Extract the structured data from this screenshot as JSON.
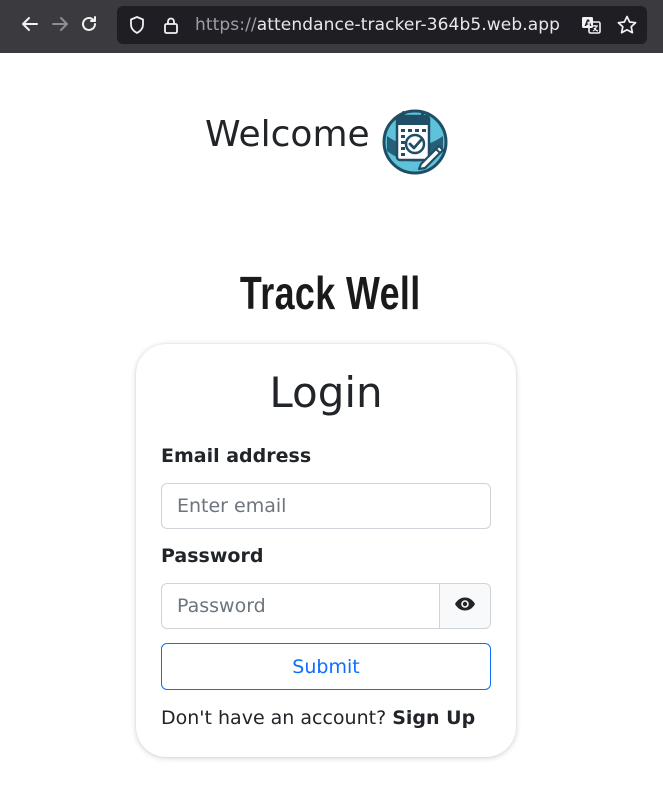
{
  "browser": {
    "url_scheme": "https://",
    "url_host": "attendance-tracker-364b5.web.app",
    "icons": [
      "back-arrow-icon",
      "forward-arrow-icon",
      "reload-icon",
      "shield-icon",
      "lock-icon",
      "translate-icon",
      "star-icon"
    ]
  },
  "header": {
    "welcome_text": "Welcome",
    "logo_icon": "calendar-check-logo-icon"
  },
  "brand": {
    "name": "Track Well"
  },
  "login": {
    "title": "Login",
    "email_label": "Email address",
    "email_placeholder": "Enter email",
    "email_value": "",
    "password_label": "Password",
    "password_placeholder": "Password",
    "password_value": "",
    "toggle_icon": "eye-icon",
    "submit_label": "Submit",
    "signup_prompt": "Don't have an account?",
    "signup_link": "Sign Up"
  },
  "colors": {
    "toolbar_bg": "#3b3b3f",
    "urlbar_bg": "#1f1e25",
    "primary": "#0d6efd",
    "text": "#212529",
    "input_border": "#ced4da",
    "logo_teal": "#1f4e66",
    "logo_light": "#5ec2d9"
  }
}
